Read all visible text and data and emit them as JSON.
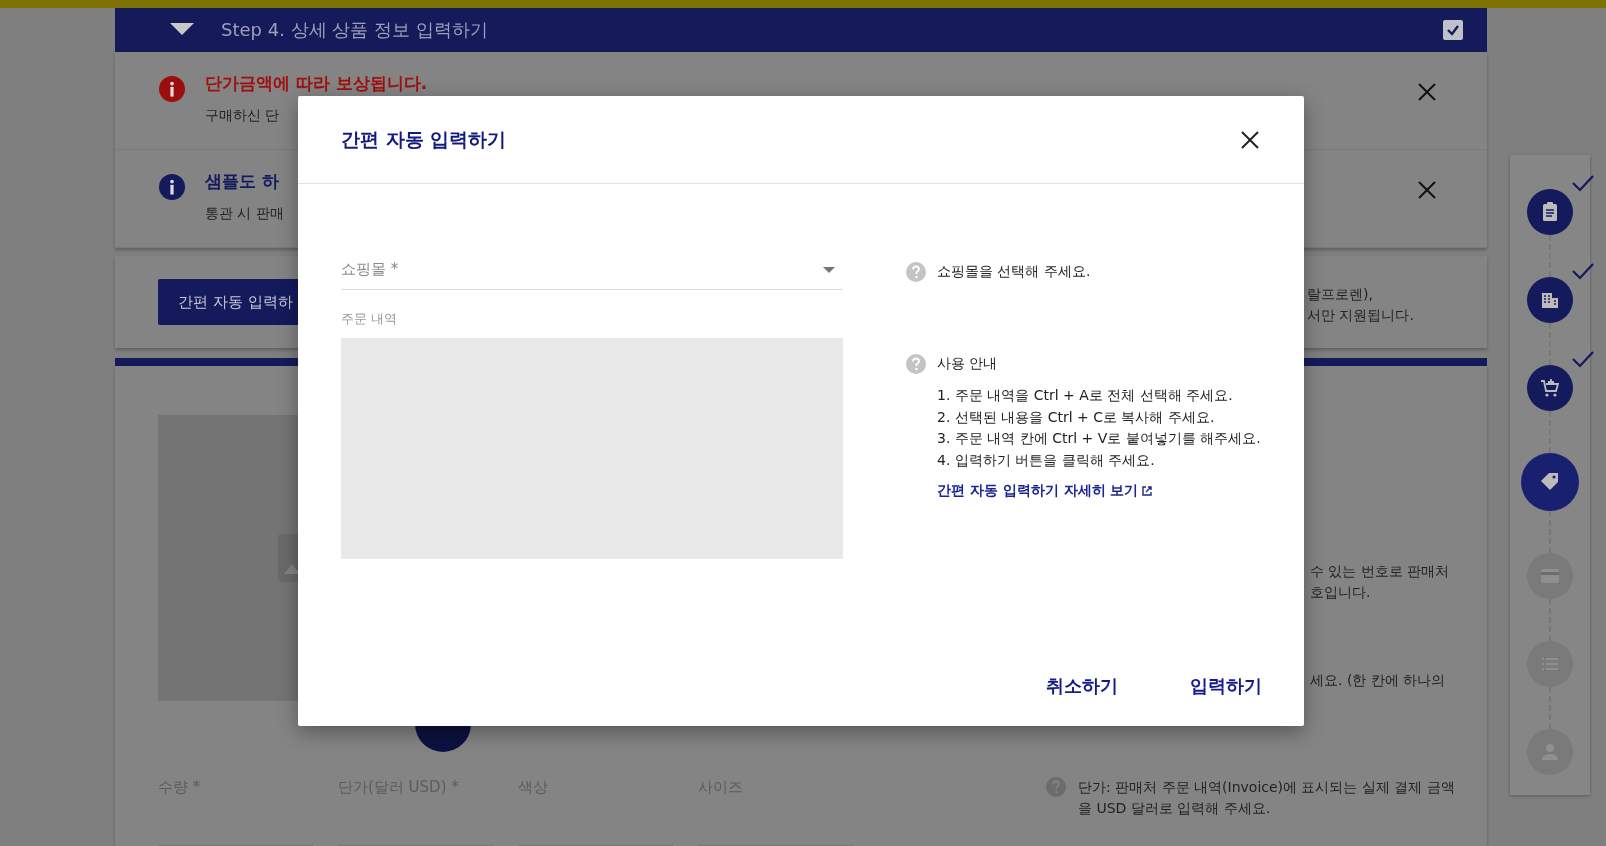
{
  "step_header": {
    "title": "Step 4. 상세 상품 정보 입력하기",
    "checked": true
  },
  "notices": [
    {
      "kind": "warning",
      "title": "단가금액에 따라 보상됩니다.",
      "text": "구매하신 단"
    },
    {
      "kind": "info",
      "title": "샘플도 하",
      "text": "통관 시 판매"
    }
  ],
  "auto_input": {
    "button": "간편 자동 입력하",
    "notes": [
      "랄프로렌),",
      "서만 지원됩니다."
    ]
  },
  "product": {
    "notes": [
      "수 있는 번호로 판매처",
      "호입니다."
    ],
    "note2": "세요. (한 칸에 하나의",
    "fields": [
      {
        "label": "수량 *"
      },
      {
        "label": "단가(달러 USD) *"
      },
      {
        "label": "색상"
      },
      {
        "label": "사이즈"
      }
    ],
    "price_help": "단가: 판매처 주문 내역(Invoice)에 표시되는 실제 결제 금액을 USD 달러로 입력해 주세요."
  },
  "steps": [
    {
      "checked": true,
      "selected": false
    },
    {
      "checked": true,
      "selected": false
    },
    {
      "checked": true,
      "selected": false
    },
    {
      "checked": false,
      "selected": true
    },
    {
      "checked": false,
      "selected": false
    },
    {
      "checked": false,
      "selected": false
    },
    {
      "checked": false,
      "selected": false
    }
  ],
  "modal": {
    "title": "간편 자동 입력하기",
    "shop_field": {
      "label": "쇼핑몰 *"
    },
    "shop_help": "쇼핑몰을 선택해 주세요.",
    "order_label": "주문 내역",
    "guide_title": "사용 안내",
    "guide_steps": [
      "1. 주문 내역을 Ctrl + A로 전체 선택해 주세요.",
      "2. 선택된 내용을 Ctrl + C로 복사해 주세요.",
      "3. 주문 내역 칸에 Ctrl + V로 붙여넣기를 해주세요.",
      "4. 입력하기 버튼을 클릭해 주세요."
    ],
    "guide_link": "간편 자동 입력하기 자세히 보기",
    "buttons": [
      "취소하기",
      "입력하기"
    ]
  }
}
